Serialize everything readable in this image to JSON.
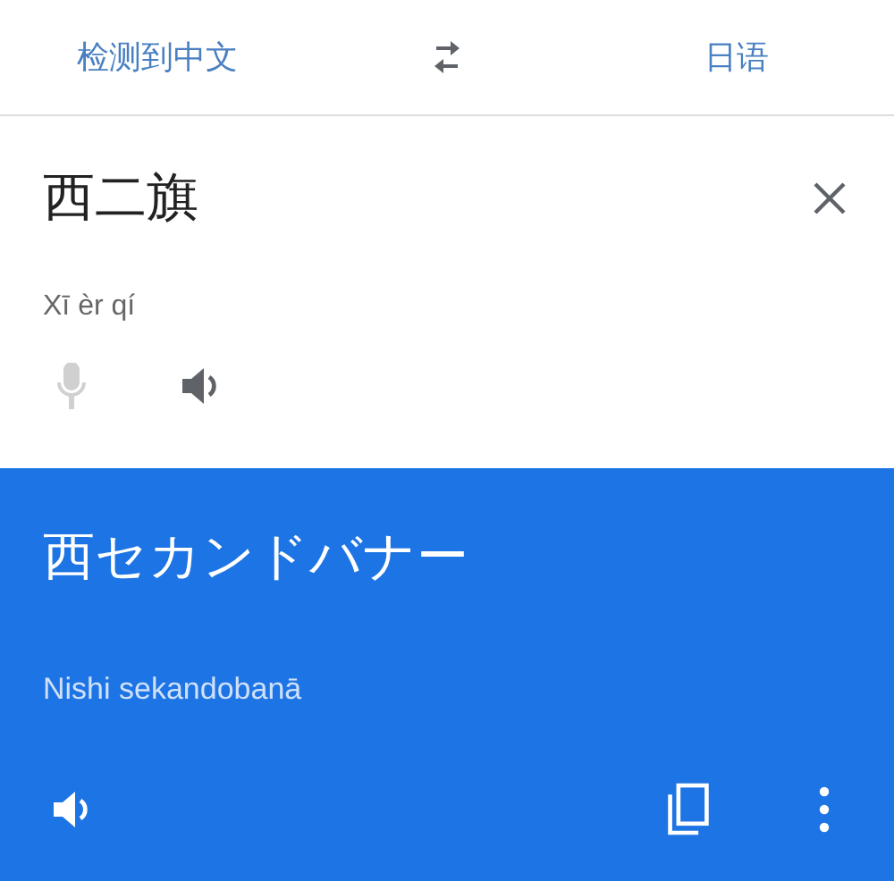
{
  "language_bar": {
    "source_language": "检测到中文",
    "target_language": "日语"
  },
  "source": {
    "text": "西二旗",
    "romanization": "Xī èr qí",
    "mic_disabled": true
  },
  "translation": {
    "text": "西セカンドバナー",
    "romanization": "Nishi sekandobanā"
  }
}
